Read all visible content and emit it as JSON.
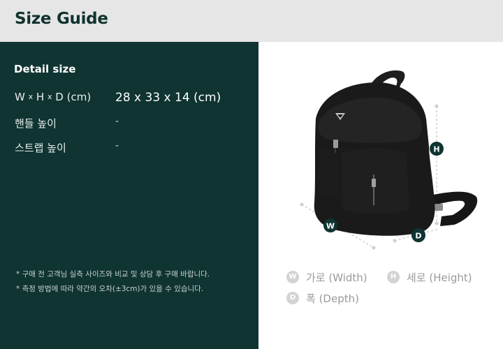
{
  "header": {
    "title": "Size Guide"
  },
  "detail": {
    "title": "Detail size",
    "rows": [
      {
        "label_w": "W",
        "label_h": "H",
        "label_d": "D",
        "label_unit": "(cm)",
        "sep": "x",
        "value": "28 x 33 x 14 (cm)"
      },
      {
        "label": "핸들 높이",
        "value": "-"
      },
      {
        "label": "스트랩 높이",
        "value": "-"
      }
    ]
  },
  "notes": [
    "* 구매 전 고객님 실측 사이즈와 비교 및 상담 후 구매 바랍니다.",
    "* 측정 방법에 따라 약간의 오차(±3cm)가 있을 수 있습니다."
  ],
  "illustration": {
    "badges": {
      "w": "W",
      "h": "H",
      "d": "D"
    },
    "colors": {
      "badge": "#0f3431",
      "guide": "#c8c8c8",
      "bag": "#1a1a1a"
    }
  },
  "legend": [
    {
      "badge": "W",
      "text": "가로 (Width)"
    },
    {
      "badge": "H",
      "text": "세로 (Height)"
    },
    {
      "badge": "D",
      "text": "폭 (Depth)"
    }
  ]
}
